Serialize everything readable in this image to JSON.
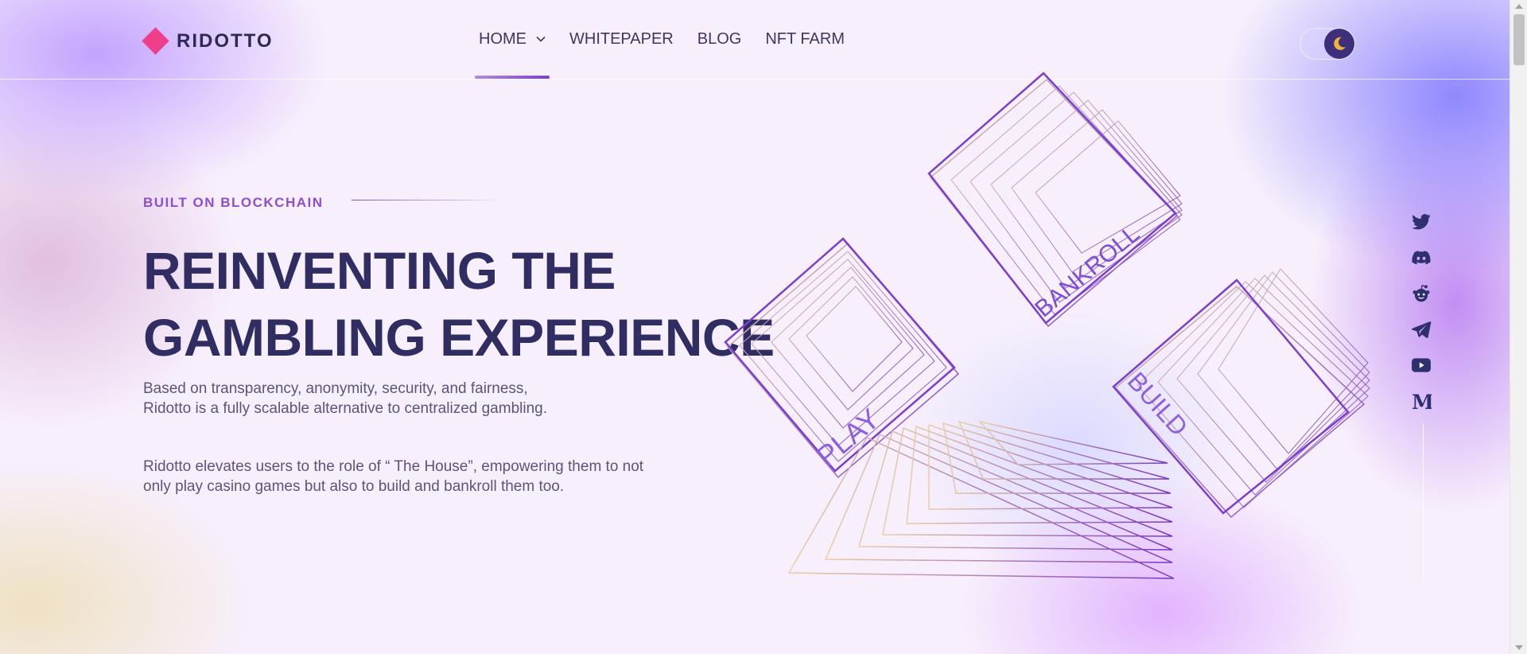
{
  "header": {
    "logo_text": "RIDOTTO",
    "nav": [
      {
        "label": "HOME",
        "active": true,
        "has_dropdown": true
      },
      {
        "label": "WHITEPAPER"
      },
      {
        "label": "BLOG"
      },
      {
        "label": "NFT FARM"
      }
    ],
    "theme_toggle_icon": "moon-icon"
  },
  "hero": {
    "eyebrow": "BUILT ON BLOCKCHAIN",
    "headline_line1": "REINVENTING THE",
    "headline_line2": "GAMBLING EXPERIENCE",
    "paragraph1": "Based on transparency, anonymity, security, and fairness, Ridotto is a fully scalable alternative to centralized gambling.",
    "paragraph2": "Ridotto elevates users to the role of “ The House”, empowering them to not only play casino games but also to build and bankroll them too."
  },
  "illustration": {
    "labels": [
      "PLAY",
      "BANKROLL",
      "BUILD"
    ]
  },
  "socials": [
    "twitter-icon",
    "discord-icon",
    "reddit-icon",
    "telegram-icon",
    "youtube-icon",
    "medium-icon"
  ],
  "colors": {
    "accent": "#8a4fd4",
    "heading": "#2f2d62",
    "brand_pink": "#ef3f8b",
    "icon": "#2d2f6e"
  }
}
